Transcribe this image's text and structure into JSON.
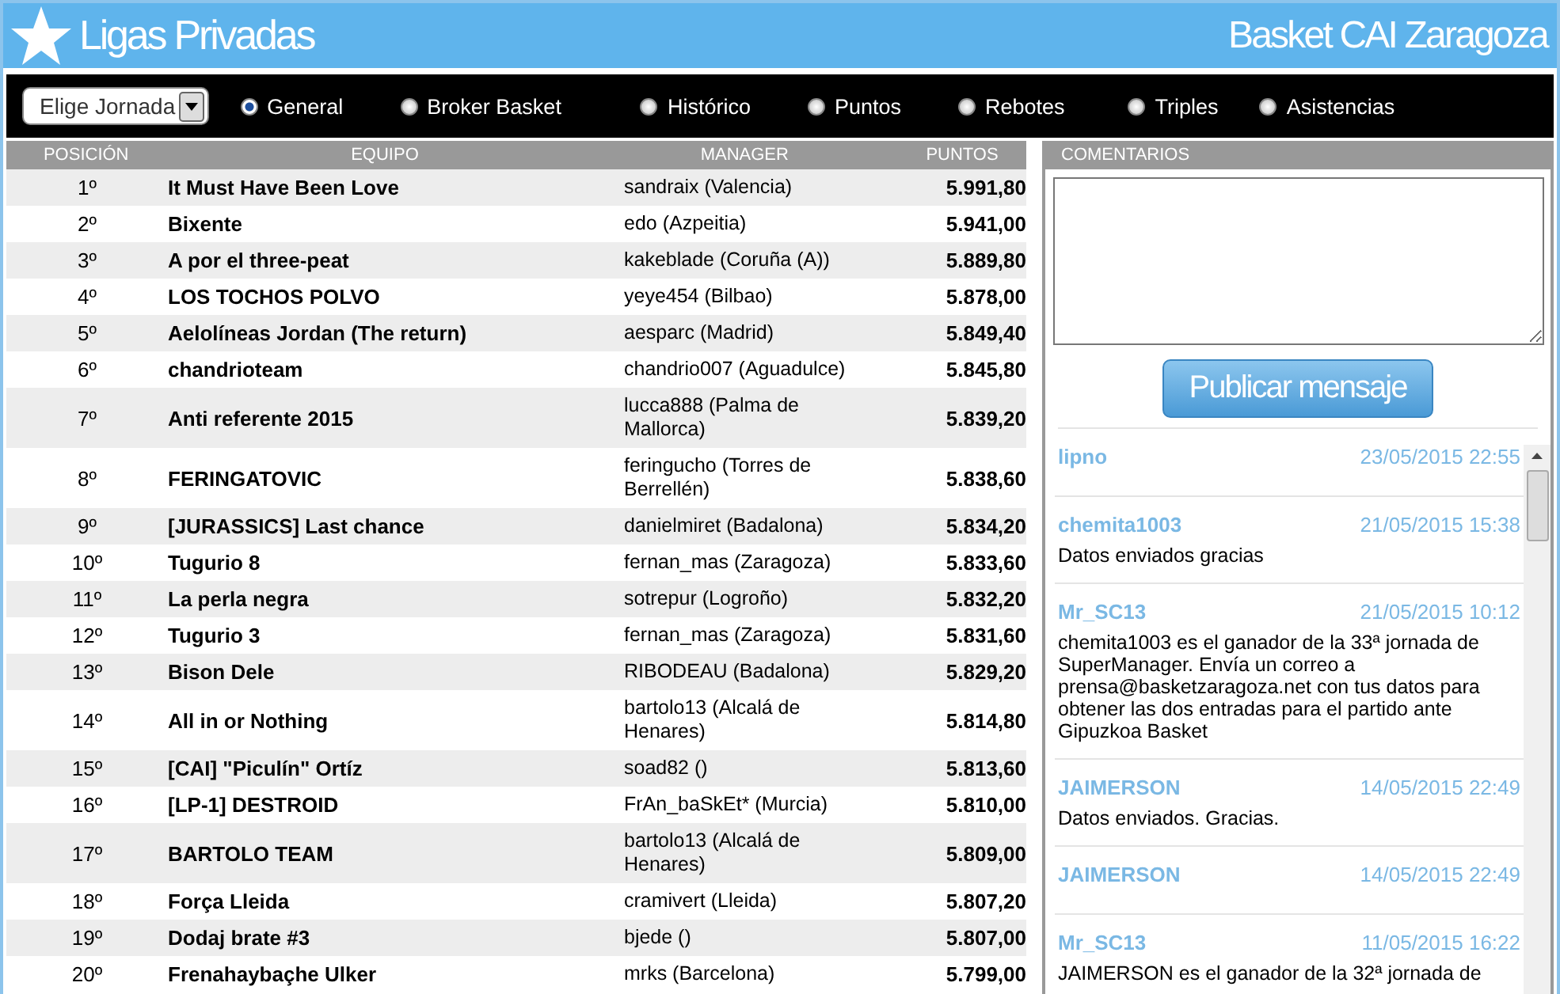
{
  "header": {
    "title": "Ligas Privadas",
    "team": "Basket CAI Zaragoza"
  },
  "nav": {
    "select": {
      "value": "Elige Jornada"
    },
    "options": [
      {
        "label": "General",
        "selected": true
      },
      {
        "label": "Broker Basket",
        "selected": false
      },
      {
        "label": "Histórico",
        "selected": false
      },
      {
        "label": "Puntos",
        "selected": false
      },
      {
        "label": "Rebotes",
        "selected": false
      },
      {
        "label": "Triples",
        "selected": false
      },
      {
        "label": "Asistencias",
        "selected": false
      }
    ]
  },
  "table": {
    "columns": [
      "POSICIÓN",
      "EQUIPO",
      "MANAGER",
      "PUNTOS"
    ],
    "rows": [
      [
        "1º",
        "It Must Have Been Love",
        "sandraix (Valencia)",
        "5.991,80"
      ],
      [
        "2º",
        "Bixente",
        "edo (Azpeitia)",
        "5.941,00"
      ],
      [
        "3º",
        "A por el three-peat",
        "kakeblade (Coruña (A))",
        "5.889,80"
      ],
      [
        "4º",
        "LOS TOCHOS POLVO",
        "yeye454 (Bilbao)",
        "5.878,00"
      ],
      [
        "5º",
        "Aelolíneas Jordan (The return)",
        "aesparc (Madrid)",
        "5.849,40"
      ],
      [
        "6º",
        "chandrioteam",
        "chandrio007 (Aguadulce)",
        "5.845,80"
      ],
      [
        "7º",
        "Anti referente 2015",
        "lucca888 (Palma de Mallorca)",
        "5.839,20"
      ],
      [
        "8º",
        "FERINGATOVIC",
        "feringucho (Torres de Berrellén)",
        "5.838,60"
      ],
      [
        "9º",
        "[JURASSICS] Last chance",
        "danielmiret (Badalona)",
        "5.834,20"
      ],
      [
        "10º",
        "Tugurio 8",
        "fernan_mas (Zaragoza)",
        "5.833,60"
      ],
      [
        "11º",
        "La perla negra",
        "sotrepur (Logroño)",
        "5.832,20"
      ],
      [
        "12º",
        "Tugurio 3",
        "fernan_mas (Zaragoza)",
        "5.831,60"
      ],
      [
        "13º",
        "Bison Dele",
        "RIBODEAU (Badalona)",
        "5.829,20"
      ],
      [
        "14º",
        "All in or Nothing",
        "bartolo13 (Alcalá de Henares)",
        "5.814,80"
      ],
      [
        "15º",
        "[CAI] \"Piculín\" Ortíz",
        "soad82 ()",
        "5.813,60"
      ],
      [
        "16º",
        "[LP-1] DESTROID",
        "FrAn_baSkEt* (Murcia)",
        "5.810,00"
      ],
      [
        "17º",
        "BARTOLO TEAM",
        "bartolo13 (Alcalá de Henares)",
        "5.809,00"
      ],
      [
        "18º",
        "Força Lleida",
        "cramivert (Lleida)",
        "5.807,20"
      ],
      [
        "19º",
        "Dodaj brate #3",
        "bjede ()",
        "5.807,00"
      ],
      [
        "20º",
        "Frenahaybaçhe Ulker",
        "mrks (Barcelona)",
        "5.799,00"
      ]
    ]
  },
  "comments": {
    "title": "COMENTARIOS",
    "button": "Publicar mensaje",
    "items": [
      {
        "user": "lipno",
        "date": "23/05/2015 22:55"
      },
      {
        "user": "chemita1003",
        "date": "21/05/2015 15:38",
        "text": "Datos enviados gracias"
      },
      {
        "user": "Mr_SC13",
        "date": "21/05/2015 10:12",
        "text": "chemita1003 es el ganador de la 33ª jornada de SuperManager. Envía un correo a prensa@basketzaragoza.net con tus datos para obtener las dos entradas para el partido ante Gipuzkoa Basket"
      },
      {
        "user": "JAIMERSON",
        "date": "14/05/2015 22:49",
        "text": "Datos enviados. Gracias."
      },
      {
        "user": "JAIMERSON",
        "date": "14/05/2015 22:49"
      },
      {
        "user": "Mr_SC13",
        "date": "11/05/2015 16:22",
        "text": "JAIMERSON es el ganador de la 32ª jornada de"
      }
    ]
  }
}
